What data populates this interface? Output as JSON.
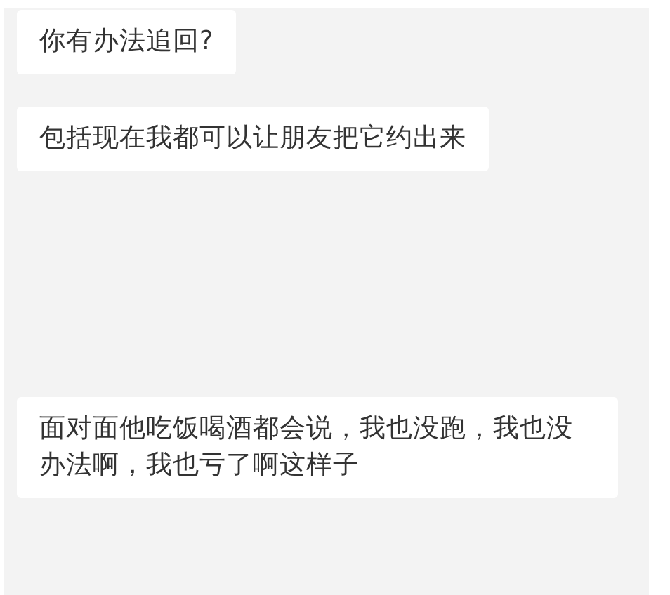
{
  "messages": [
    {
      "text": "你有办法追回?"
    },
    {
      "text": "包括现在我都可以让朋友把它约出来"
    },
    {
      "text": "面对面他吃饭喝酒都会说，我也没跑，我也没办法啊，我也亏了啊这样子"
    }
  ]
}
